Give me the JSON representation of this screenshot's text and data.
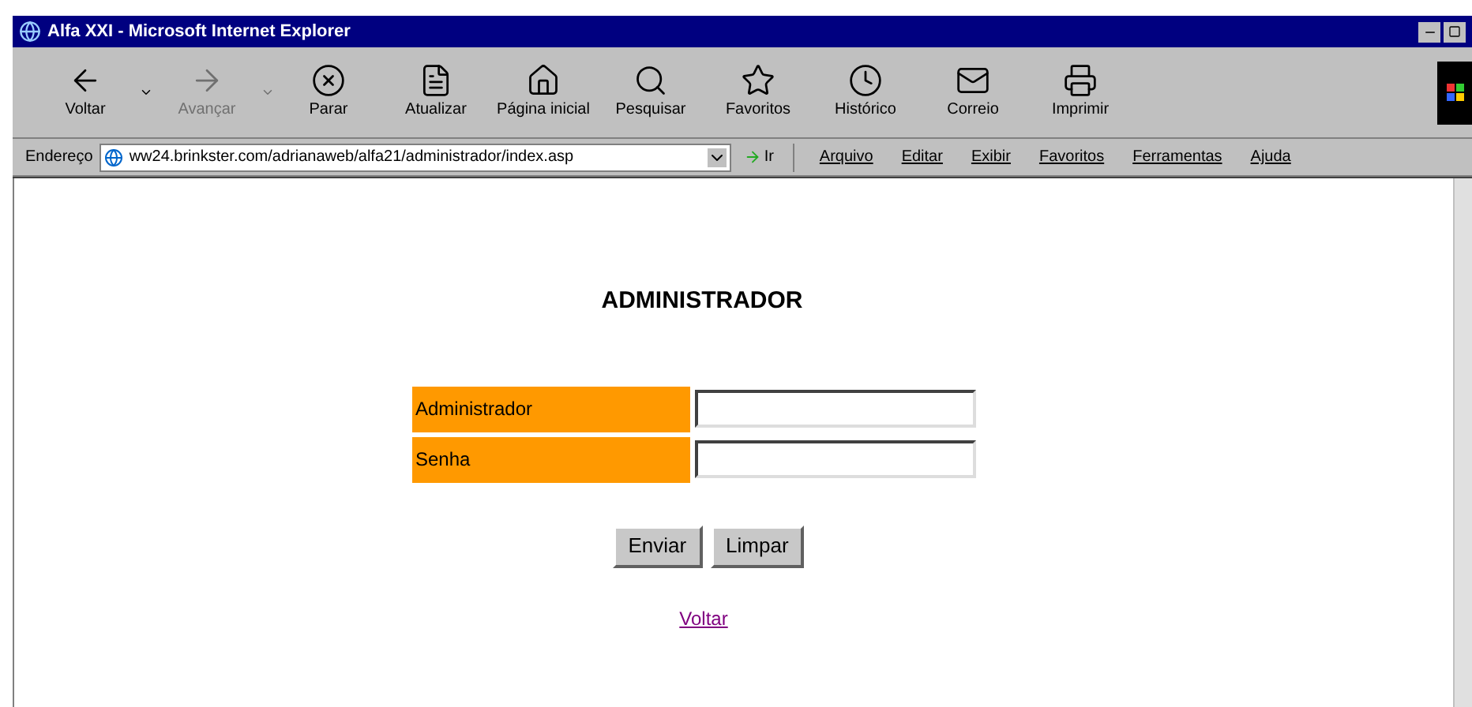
{
  "window": {
    "title": "Alfa XXI - Microsoft Internet Explorer"
  },
  "toolbar": [
    {
      "label": "Voltar",
      "disabled": false,
      "dropdown": true
    },
    {
      "label": "Avançar",
      "disabled": true,
      "dropdown": true
    },
    {
      "label": "Parar",
      "disabled": false,
      "dropdown": false
    },
    {
      "label": "Atualizar",
      "disabled": false,
      "dropdown": false
    },
    {
      "label": "Página inicial",
      "disabled": false,
      "dropdown": false
    },
    {
      "label": "Pesquisar",
      "disabled": false,
      "dropdown": false
    },
    {
      "label": "Favoritos",
      "disabled": false,
      "dropdown": false
    },
    {
      "label": "Histórico",
      "disabled": false,
      "dropdown": false
    },
    {
      "label": "Correio",
      "disabled": false,
      "dropdown": false
    },
    {
      "label": "Imprimir",
      "disabled": false,
      "dropdown": false
    }
  ],
  "address": {
    "label": "Endereço",
    "value": "ww24.brinkster.com/adrianaweb/alfa21/administrador/index.asp",
    "go": "Ir"
  },
  "menu": [
    "Arquivo",
    "Editar",
    "Exibir",
    "Favoritos",
    "Ferramentas",
    "Ajuda"
  ],
  "page": {
    "heading": "ADMINISTRADOR",
    "fields": [
      {
        "label": "Administrador"
      },
      {
        "label": "Senha"
      }
    ],
    "buttons": [
      "Enviar",
      "Limpar"
    ],
    "link": "Voltar"
  }
}
